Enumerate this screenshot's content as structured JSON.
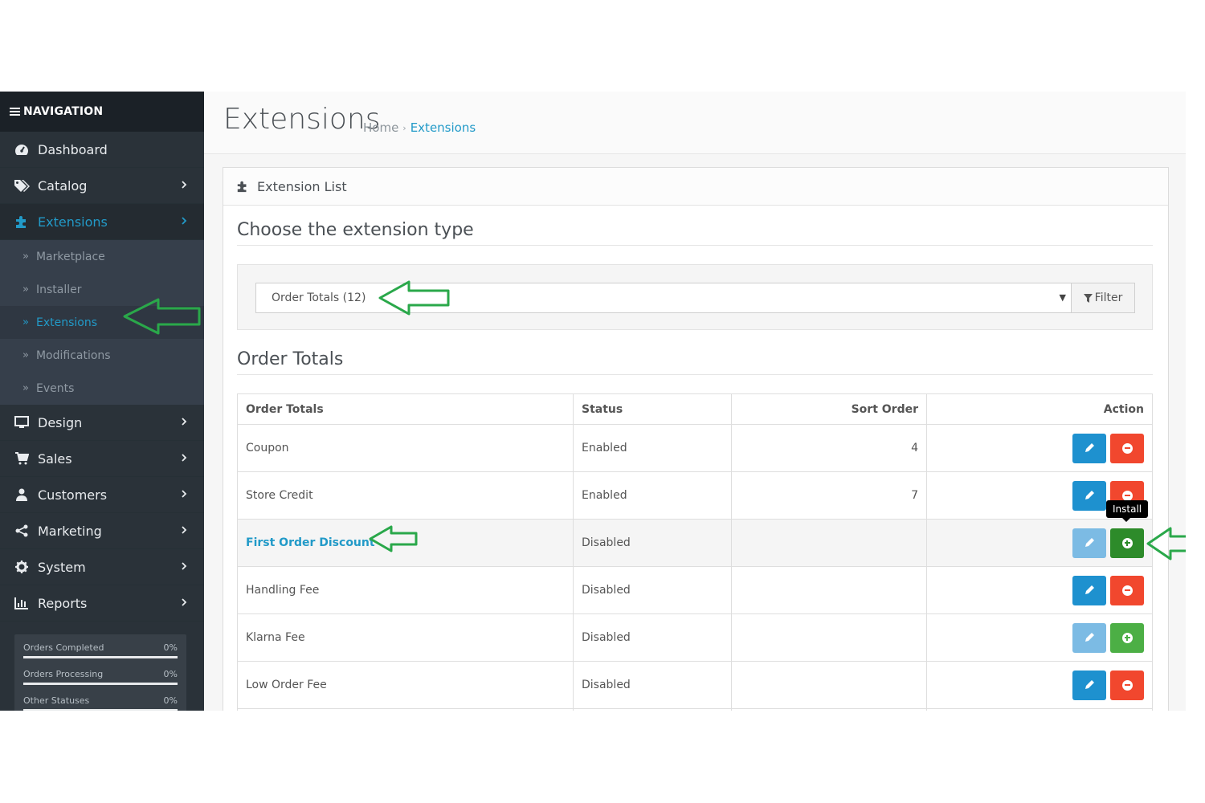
{
  "sidebar": {
    "nav_header": "NAVIGATION",
    "items": [
      {
        "label": "Dashboard",
        "icon": "dashboard-icon"
      },
      {
        "label": "Catalog",
        "icon": "tags-icon"
      },
      {
        "label": "Extensions",
        "icon": "puzzle-icon"
      },
      {
        "label": "Design",
        "icon": "desktop-icon"
      },
      {
        "label": "Sales",
        "icon": "cart-icon"
      },
      {
        "label": "Customers",
        "icon": "user-icon"
      },
      {
        "label": "Marketing",
        "icon": "share-icon"
      },
      {
        "label": "System",
        "icon": "cog-icon"
      },
      {
        "label": "Reports",
        "icon": "bar-chart-icon"
      }
    ],
    "submenu": [
      "Marketplace",
      "Installer",
      "Extensions",
      "Modifications",
      "Events"
    ],
    "stats": [
      {
        "label": "Orders Completed",
        "value": "0%"
      },
      {
        "label": "Orders Processing",
        "value": "0%"
      },
      {
        "label": "Other Statuses",
        "value": "0%"
      }
    ]
  },
  "header": {
    "title": "Extensions",
    "breadcrumb": [
      "Home",
      "Extensions"
    ]
  },
  "panel": {
    "heading": "Extension List",
    "choose_legend": "Choose the extension type",
    "select_value": "Order Totals (12)",
    "filter_label": "Filter",
    "section_legend": "Order Totals"
  },
  "table": {
    "headers": [
      "Order Totals",
      "Status",
      "Sort Order",
      "Action"
    ],
    "rows": [
      {
        "name": "Coupon",
        "status": "Enabled",
        "sort": "4",
        "installed": true
      },
      {
        "name": "Store Credit",
        "status": "Enabled",
        "sort": "7",
        "installed": true
      },
      {
        "name": "First Order Discount",
        "status": "Disabled",
        "sort": "",
        "installed": false
      },
      {
        "name": "Handling Fee",
        "status": "Disabled",
        "sort": "",
        "installed": true
      },
      {
        "name": "Klarna Fee",
        "status": "Disabled",
        "sort": "",
        "installed": false
      },
      {
        "name": "Low Order Fee",
        "status": "Disabled",
        "sort": "",
        "installed": true
      }
    ]
  },
  "tooltip": "Install",
  "colors": {
    "accent": "#229ac8",
    "sidebar_bg": "#2a3239",
    "edit": "#1e91cf",
    "delete": "#f1472e",
    "install": "#4caf45",
    "annotation_arrow": "#2aa84a"
  }
}
